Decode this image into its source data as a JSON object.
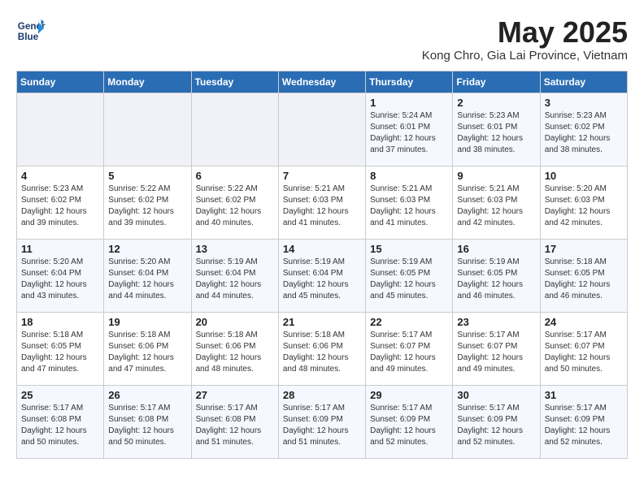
{
  "header": {
    "logo_line1": "General",
    "logo_line2": "Blue",
    "month_year": "May 2025",
    "location": "Kong Chro, Gia Lai Province, Vietnam"
  },
  "weekdays": [
    "Sunday",
    "Monday",
    "Tuesday",
    "Wednesday",
    "Thursday",
    "Friday",
    "Saturday"
  ],
  "weeks": [
    [
      {
        "day": "",
        "info": ""
      },
      {
        "day": "",
        "info": ""
      },
      {
        "day": "",
        "info": ""
      },
      {
        "day": "",
        "info": ""
      },
      {
        "day": "1",
        "info": "Sunrise: 5:24 AM\nSunset: 6:01 PM\nDaylight: 12 hours\nand 37 minutes."
      },
      {
        "day": "2",
        "info": "Sunrise: 5:23 AM\nSunset: 6:01 PM\nDaylight: 12 hours\nand 38 minutes."
      },
      {
        "day": "3",
        "info": "Sunrise: 5:23 AM\nSunset: 6:02 PM\nDaylight: 12 hours\nand 38 minutes."
      }
    ],
    [
      {
        "day": "4",
        "info": "Sunrise: 5:23 AM\nSunset: 6:02 PM\nDaylight: 12 hours\nand 39 minutes."
      },
      {
        "day": "5",
        "info": "Sunrise: 5:22 AM\nSunset: 6:02 PM\nDaylight: 12 hours\nand 39 minutes."
      },
      {
        "day": "6",
        "info": "Sunrise: 5:22 AM\nSunset: 6:02 PM\nDaylight: 12 hours\nand 40 minutes."
      },
      {
        "day": "7",
        "info": "Sunrise: 5:21 AM\nSunset: 6:03 PM\nDaylight: 12 hours\nand 41 minutes."
      },
      {
        "day": "8",
        "info": "Sunrise: 5:21 AM\nSunset: 6:03 PM\nDaylight: 12 hours\nand 41 minutes."
      },
      {
        "day": "9",
        "info": "Sunrise: 5:21 AM\nSunset: 6:03 PM\nDaylight: 12 hours\nand 42 minutes."
      },
      {
        "day": "10",
        "info": "Sunrise: 5:20 AM\nSunset: 6:03 PM\nDaylight: 12 hours\nand 42 minutes."
      }
    ],
    [
      {
        "day": "11",
        "info": "Sunrise: 5:20 AM\nSunset: 6:04 PM\nDaylight: 12 hours\nand 43 minutes."
      },
      {
        "day": "12",
        "info": "Sunrise: 5:20 AM\nSunset: 6:04 PM\nDaylight: 12 hours\nand 44 minutes."
      },
      {
        "day": "13",
        "info": "Sunrise: 5:19 AM\nSunset: 6:04 PM\nDaylight: 12 hours\nand 44 minutes."
      },
      {
        "day": "14",
        "info": "Sunrise: 5:19 AM\nSunset: 6:04 PM\nDaylight: 12 hours\nand 45 minutes."
      },
      {
        "day": "15",
        "info": "Sunrise: 5:19 AM\nSunset: 6:05 PM\nDaylight: 12 hours\nand 45 minutes."
      },
      {
        "day": "16",
        "info": "Sunrise: 5:19 AM\nSunset: 6:05 PM\nDaylight: 12 hours\nand 46 minutes."
      },
      {
        "day": "17",
        "info": "Sunrise: 5:18 AM\nSunset: 6:05 PM\nDaylight: 12 hours\nand 46 minutes."
      }
    ],
    [
      {
        "day": "18",
        "info": "Sunrise: 5:18 AM\nSunset: 6:05 PM\nDaylight: 12 hours\nand 47 minutes."
      },
      {
        "day": "19",
        "info": "Sunrise: 5:18 AM\nSunset: 6:06 PM\nDaylight: 12 hours\nand 47 minutes."
      },
      {
        "day": "20",
        "info": "Sunrise: 5:18 AM\nSunset: 6:06 PM\nDaylight: 12 hours\nand 48 minutes."
      },
      {
        "day": "21",
        "info": "Sunrise: 5:18 AM\nSunset: 6:06 PM\nDaylight: 12 hours\nand 48 minutes."
      },
      {
        "day": "22",
        "info": "Sunrise: 5:17 AM\nSunset: 6:07 PM\nDaylight: 12 hours\nand 49 minutes."
      },
      {
        "day": "23",
        "info": "Sunrise: 5:17 AM\nSunset: 6:07 PM\nDaylight: 12 hours\nand 49 minutes."
      },
      {
        "day": "24",
        "info": "Sunrise: 5:17 AM\nSunset: 6:07 PM\nDaylight: 12 hours\nand 50 minutes."
      }
    ],
    [
      {
        "day": "25",
        "info": "Sunrise: 5:17 AM\nSunset: 6:08 PM\nDaylight: 12 hours\nand 50 minutes."
      },
      {
        "day": "26",
        "info": "Sunrise: 5:17 AM\nSunset: 6:08 PM\nDaylight: 12 hours\nand 50 minutes."
      },
      {
        "day": "27",
        "info": "Sunrise: 5:17 AM\nSunset: 6:08 PM\nDaylight: 12 hours\nand 51 minutes."
      },
      {
        "day": "28",
        "info": "Sunrise: 5:17 AM\nSunset: 6:09 PM\nDaylight: 12 hours\nand 51 minutes."
      },
      {
        "day": "29",
        "info": "Sunrise: 5:17 AM\nSunset: 6:09 PM\nDaylight: 12 hours\nand 52 minutes."
      },
      {
        "day": "30",
        "info": "Sunrise: 5:17 AM\nSunset: 6:09 PM\nDaylight: 12 hours\nand 52 minutes."
      },
      {
        "day": "31",
        "info": "Sunrise: 5:17 AM\nSunset: 6:09 PM\nDaylight: 12 hours\nand 52 minutes."
      }
    ]
  ]
}
